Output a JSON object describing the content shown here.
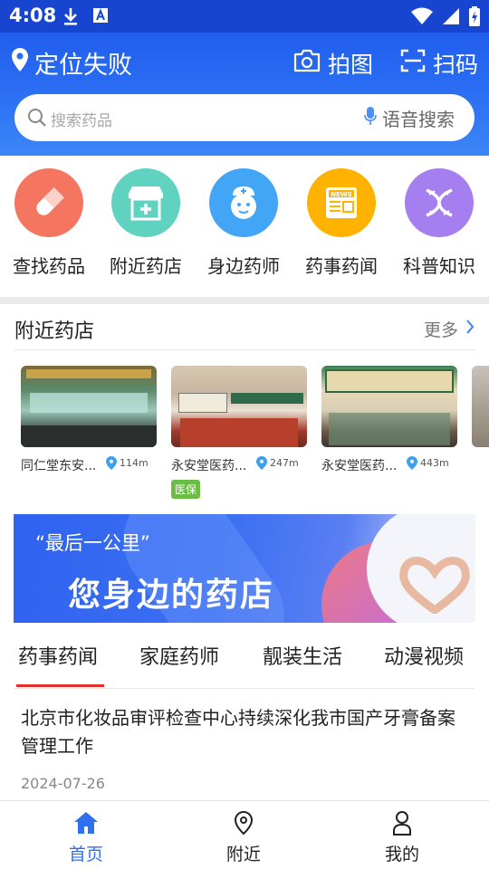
{
  "status_bar": {
    "time": "4:08"
  },
  "header": {
    "location": "定位失败",
    "photo_label": "拍图",
    "scan_label": "扫码"
  },
  "search": {
    "placeholder": "搜索药品",
    "voice_label": "语音搜索"
  },
  "menu": [
    {
      "label": "查找药品",
      "icon": "pill-icon",
      "color": "#f47560"
    },
    {
      "label": "附近药店",
      "icon": "pharmacy-store-icon",
      "color": "#5fd3c0"
    },
    {
      "label": "身边药师",
      "icon": "pharmacist-icon",
      "color": "#42a5f5"
    },
    {
      "label": "药事药闻",
      "icon": "news-icon",
      "color": "#ffb300"
    },
    {
      "label": "科普知识",
      "icon": "dna-icon",
      "color": "#a57ef0"
    }
  ],
  "nearby": {
    "title": "附近药店",
    "more_label": "更多",
    "shops": [
      {
        "name": "同仁堂东安...",
        "distance": "114m",
        "badge": ""
      },
      {
        "name": "永安堂医药...",
        "distance": "247m",
        "badge": "医保"
      },
      {
        "name": "永安堂医药...",
        "distance": "443m",
        "badge": ""
      }
    ]
  },
  "banner": {
    "quote": "“最后一公里”",
    "headline": "您身边的药店"
  },
  "tabs": [
    "药事药闻",
    "家庭药师",
    "靓装生活",
    "动漫视频"
  ],
  "article": {
    "title": "北京市化妆品审评检查中心持续深化我市国产牙膏备案管理工作",
    "date": "2024-07-26"
  },
  "bottom_nav": [
    {
      "label": "首页",
      "icon": "home-icon",
      "active": true
    },
    {
      "label": "附近",
      "icon": "location-pin-icon",
      "active": false
    },
    {
      "label": "我的",
      "icon": "user-icon",
      "active": false
    }
  ],
  "colors": {
    "brand_blue": "#1a55e8",
    "active_nav": "#2f6ff0",
    "tab_underline": "#e4302b",
    "badge_green": "#6bbd45"
  }
}
